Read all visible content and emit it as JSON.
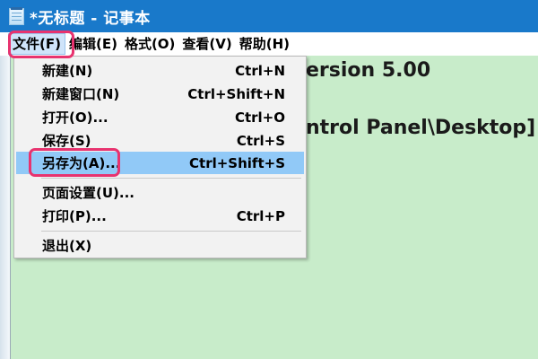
{
  "window": {
    "title": "*无标题 - 记事本",
    "icon": "notepad-icon"
  },
  "menubar": {
    "items": [
      {
        "label": "文件(F)"
      },
      {
        "label": "编辑(E)"
      },
      {
        "label": "格式(O)"
      },
      {
        "label": "查看(V)"
      },
      {
        "label": "帮助(H)"
      }
    ]
  },
  "file_menu": {
    "items": [
      {
        "label": "新建(N)",
        "shortcut": "Ctrl+N"
      },
      {
        "label": "新建窗口(N)",
        "shortcut": "Ctrl+Shift+N"
      },
      {
        "label": "打开(O)...",
        "shortcut": "Ctrl+O"
      },
      {
        "label": "保存(S)",
        "shortcut": "Ctrl+S"
      },
      {
        "label": "另存为(A)...",
        "shortcut": "Ctrl+Shift+S"
      },
      {
        "label": "页面设置(U)...",
        "shortcut": ""
      },
      {
        "label": "打印(P)...",
        "shortcut": "Ctrl+P"
      },
      {
        "label": "退出(X)",
        "shortcut": ""
      }
    ]
  },
  "editor": {
    "lines": [
      "ersion 5.00",
      "ntrol Panel\\Desktop]"
    ]
  },
  "colors": {
    "titlebar": "#1979ca",
    "editor_background": "#c8ecca",
    "selected_item": "#91c9f7",
    "highlight_ring": "#e8336f"
  }
}
